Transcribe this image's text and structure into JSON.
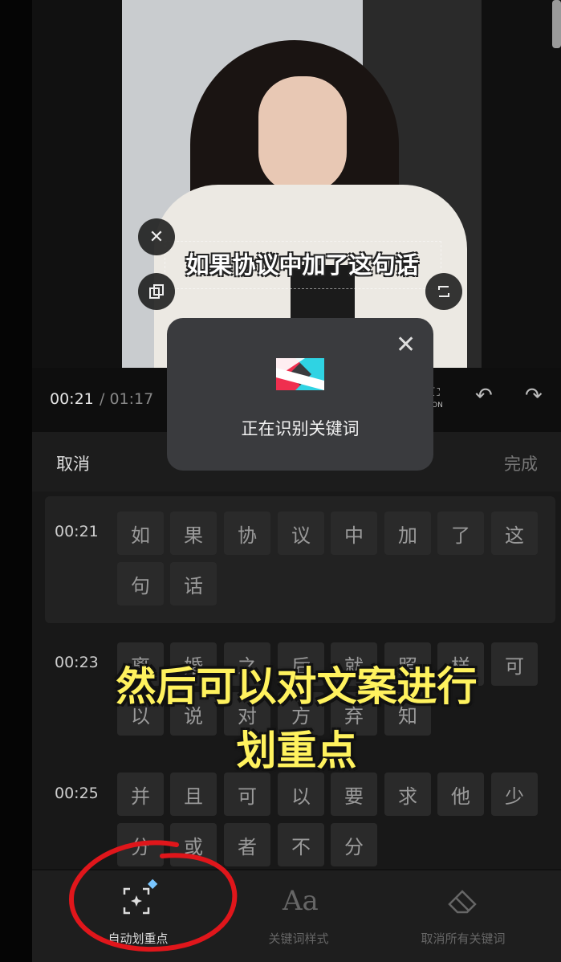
{
  "caption": "如果协议中加了这句话",
  "time": {
    "current": "00:21",
    "total": "/ 01:17"
  },
  "header": {
    "cancel": "取消",
    "done": "完成"
  },
  "rows": [
    {
      "time": "00:21",
      "chars": [
        "如",
        "果",
        "协",
        "议",
        "中",
        "加",
        "了",
        "这",
        "句",
        "话"
      ]
    },
    {
      "time": "00:23",
      "chars": [
        "离",
        "婚",
        "之",
        "后",
        "就",
        "照",
        "样",
        "可",
        "以",
        "说",
        "对",
        "方",
        "弃",
        "知"
      ]
    },
    {
      "time": "00:25",
      "chars": [
        "并",
        "且",
        "可",
        "以",
        "要",
        "求",
        "他",
        "少",
        "分",
        "或",
        "者",
        "不",
        "分"
      ]
    }
  ],
  "overlay_subtitle": {
    "line1": "然后可以对文案进行",
    "line2": "划重点"
  },
  "toast": {
    "message": "正在识别关键词"
  },
  "tools": [
    {
      "label": "自动划重点",
      "icon": "auto-highlight-icon"
    },
    {
      "label": "关键词样式",
      "icon": "text-style-icon"
    },
    {
      "label": "取消所有关键词",
      "icon": "eraser-icon"
    }
  ],
  "colors": {
    "accent_red": "#e0161b",
    "subtitle_yellow": "#fff25e",
    "logo_red": "#ef2f4f",
    "logo_cyan": "#2fd3e3"
  }
}
